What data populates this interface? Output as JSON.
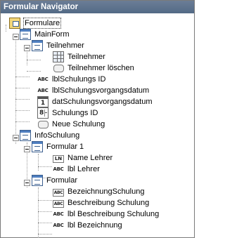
{
  "window": {
    "title": "Formular Navigator"
  },
  "tree": [
    {
      "label": "Formulare",
      "icon": "forms-root-icon",
      "selected": true
    },
    {
      "label": "MainForm",
      "icon": "form-icon"
    },
    {
      "label": "Teilnehmer",
      "icon": "form-icon"
    },
    {
      "label": "Teilnehmer",
      "icon": "table-grid-icon"
    },
    {
      "label": "Teilnehmer löschen",
      "icon": "push-button-icon"
    },
    {
      "label": "lblSchulungs ID",
      "icon": "label-abc-icon"
    },
    {
      "label": "lblSchulungsvorgangsdatum",
      "icon": "label-abc-icon"
    },
    {
      "label": "datSchulungsvorgangsdatum",
      "icon": "date-field-icon"
    },
    {
      "label": "Schulungs ID",
      "icon": "numeric-field-icon"
    },
    {
      "label": "Neue Schulung",
      "icon": "push-button-icon"
    },
    {
      "label": "InfoSchulung",
      "icon": "form-icon"
    },
    {
      "label": "Formular 1",
      "icon": "form-icon"
    },
    {
      "label": "Name Lehrer",
      "icon": "text-field-ln-icon"
    },
    {
      "label": "lbl Lehrer",
      "icon": "label-abc-icon"
    },
    {
      "label": "Formular",
      "icon": "form-icon"
    },
    {
      "label": "BezeichnungSchulung",
      "icon": "text-field-abc-icon"
    },
    {
      "label": "Beschreibung Schulung",
      "icon": "text-field-abc-icon"
    },
    {
      "label": "lbl Beschreibung Schulung",
      "icon": "label-abc-icon"
    },
    {
      "label": "lbl Bezeichnung",
      "icon": "label-abc-icon"
    }
  ],
  "icon_text": {
    "abc": "ABC",
    "ln": "LN",
    "date": "1",
    "numeric": "8"
  }
}
